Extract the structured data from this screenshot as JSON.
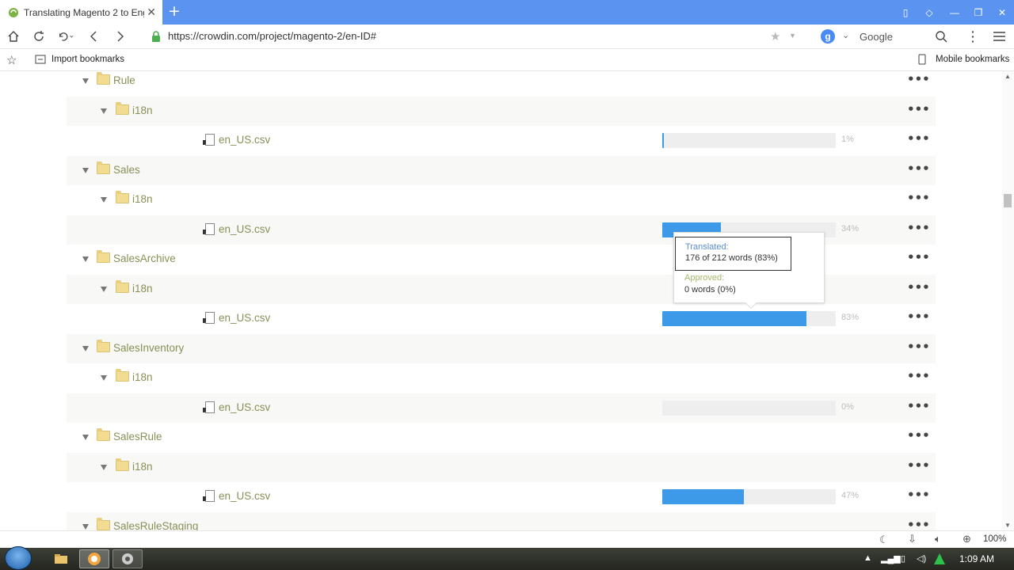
{
  "browser": {
    "tab_title": "Translating Magento 2 to Engl",
    "url": "https://crowdin.com/project/magento-2/en-ID#",
    "search_engine": "Google",
    "search_engine_letter": "g",
    "bookmarks_left": "Import bookmarks",
    "bookmarks_right": "Mobile bookmarks",
    "zoom": "100%"
  },
  "tree": [
    {
      "type": "folder",
      "name": "Rule",
      "level": 1,
      "shade": false
    },
    {
      "type": "folder",
      "name": "i18n",
      "level": 2,
      "shade": true
    },
    {
      "type": "file",
      "name": "en_US.csv",
      "level": 3,
      "shade": false,
      "progress": 1,
      "label": "1%"
    },
    {
      "type": "folder",
      "name": "Sales",
      "level": 1,
      "shade": true
    },
    {
      "type": "folder",
      "name": "i18n",
      "level": 2,
      "shade": false
    },
    {
      "type": "file",
      "name": "en_US.csv",
      "level": 3,
      "shade": true,
      "progress": 34,
      "label": "34%"
    },
    {
      "type": "folder",
      "name": "SalesArchive",
      "level": 1,
      "shade": false
    },
    {
      "type": "folder",
      "name": "i18n",
      "level": 2,
      "shade": true
    },
    {
      "type": "file",
      "name": "en_US.csv",
      "level": 3,
      "shade": false,
      "progress": 83,
      "label": "83%"
    },
    {
      "type": "folder",
      "name": "SalesInventory",
      "level": 1,
      "shade": true
    },
    {
      "type": "folder",
      "name": "i18n",
      "level": 2,
      "shade": false
    },
    {
      "type": "file",
      "name": "en_US.csv",
      "level": 3,
      "shade": true,
      "progress": 0,
      "label": "0%"
    },
    {
      "type": "folder",
      "name": "SalesRule",
      "level": 1,
      "shade": false
    },
    {
      "type": "folder",
      "name": "i18n",
      "level": 2,
      "shade": true
    },
    {
      "type": "file",
      "name": "en_US.csv",
      "level": 3,
      "shade": false,
      "progress": 47,
      "label": "47%"
    },
    {
      "type": "folder",
      "name": "SalesRuleStaging",
      "level": 1,
      "shade": true
    }
  ],
  "tooltip": {
    "translated_label": "Translated:",
    "translated_value": "176 of 212 words (83%)",
    "approved_label": "Approved:",
    "approved_value": "0 words (0%)"
  },
  "clock": "1:09 AM",
  "colors": {
    "accent": "#3d9ae8",
    "tabbar": "#5a93f0",
    "folder_text": "#8a8f56"
  }
}
